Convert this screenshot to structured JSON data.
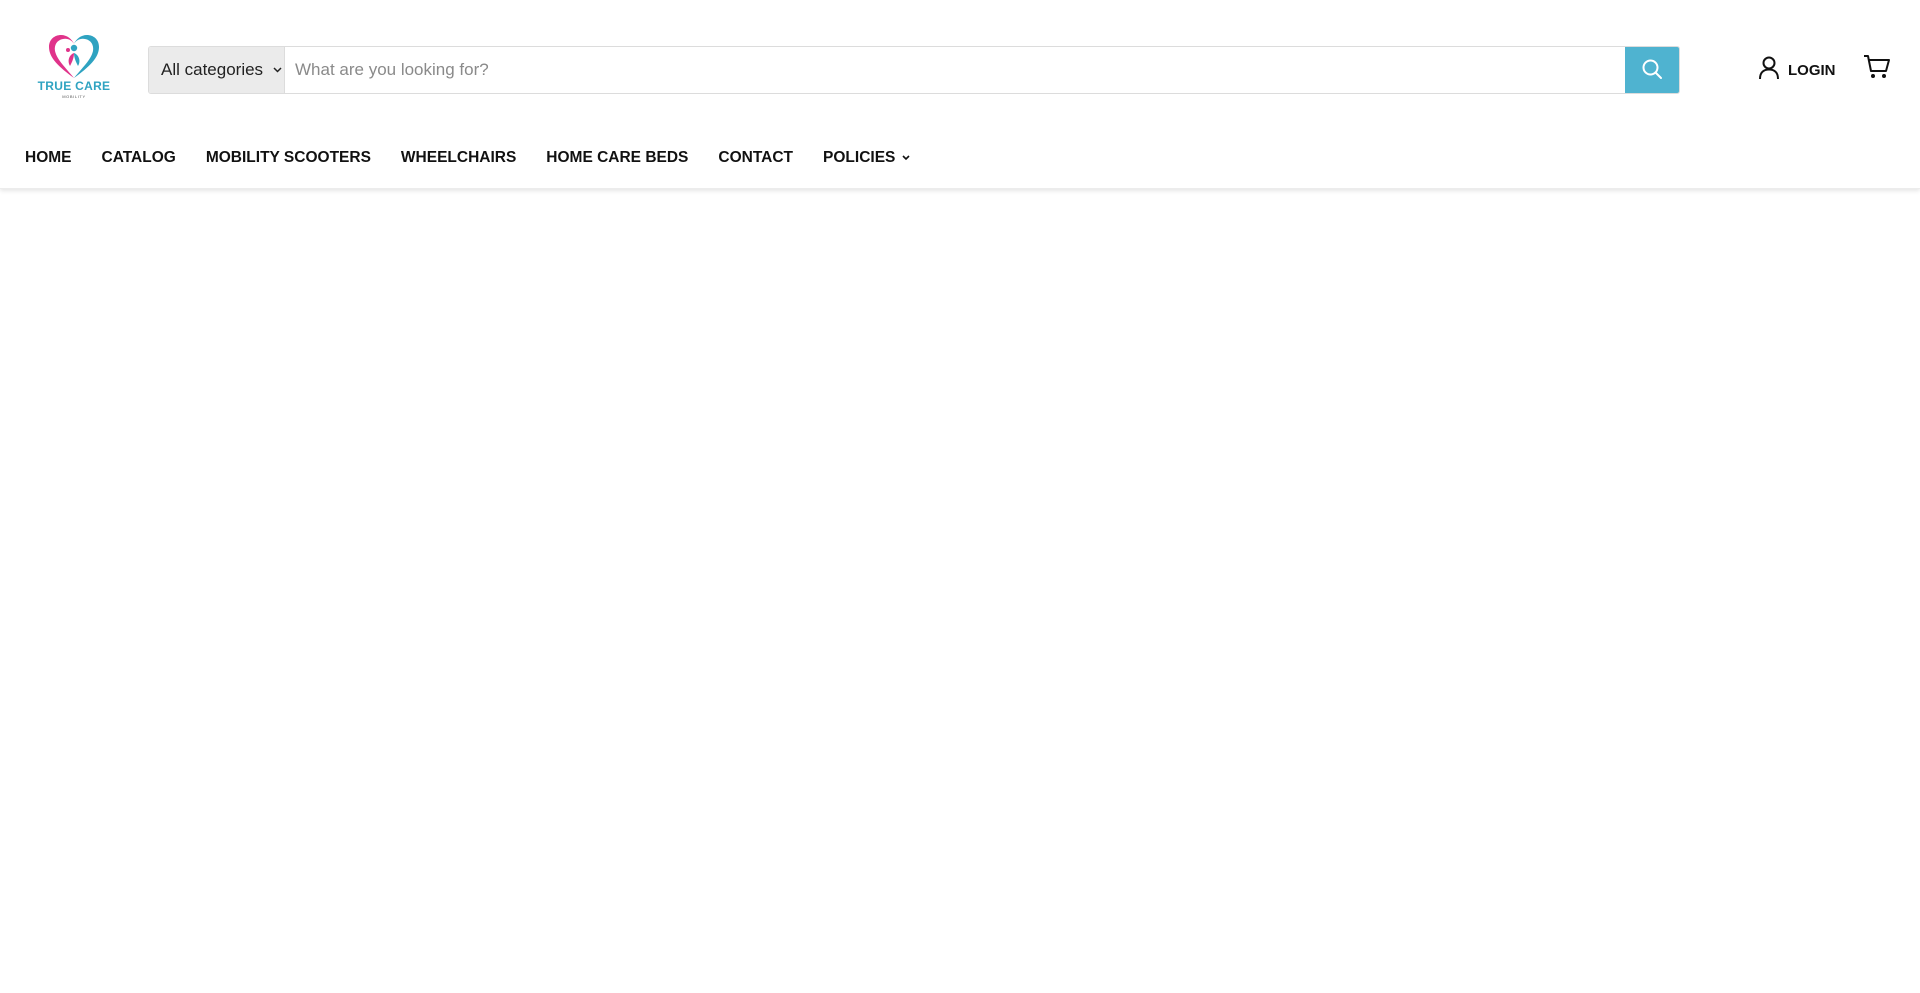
{
  "brand": {
    "name": "TRUE CARE",
    "tagline": "MOBILITY",
    "colors": {
      "pink": "#e0338a",
      "teal": "#2fa3c1",
      "navy": "#1f3b59"
    }
  },
  "search": {
    "category_label": "All categories",
    "placeholder": "What are you looking for?",
    "value": "",
    "button_color": "#4fb3d0",
    "button_icon": "search-icon"
  },
  "account": {
    "login_label": "LOGIN",
    "icon": "user-icon"
  },
  "cart": {
    "icon": "cart-icon"
  },
  "nav": {
    "items": [
      {
        "label": "HOME"
      },
      {
        "label": "CATALOG"
      },
      {
        "label": "MOBILITY SCOOTERS"
      },
      {
        "label": "WHEELCHAIRS"
      },
      {
        "label": "HOME CARE BEDS"
      },
      {
        "label": "CONTACT"
      },
      {
        "label": "POLICIES",
        "dropdown": true
      }
    ]
  }
}
